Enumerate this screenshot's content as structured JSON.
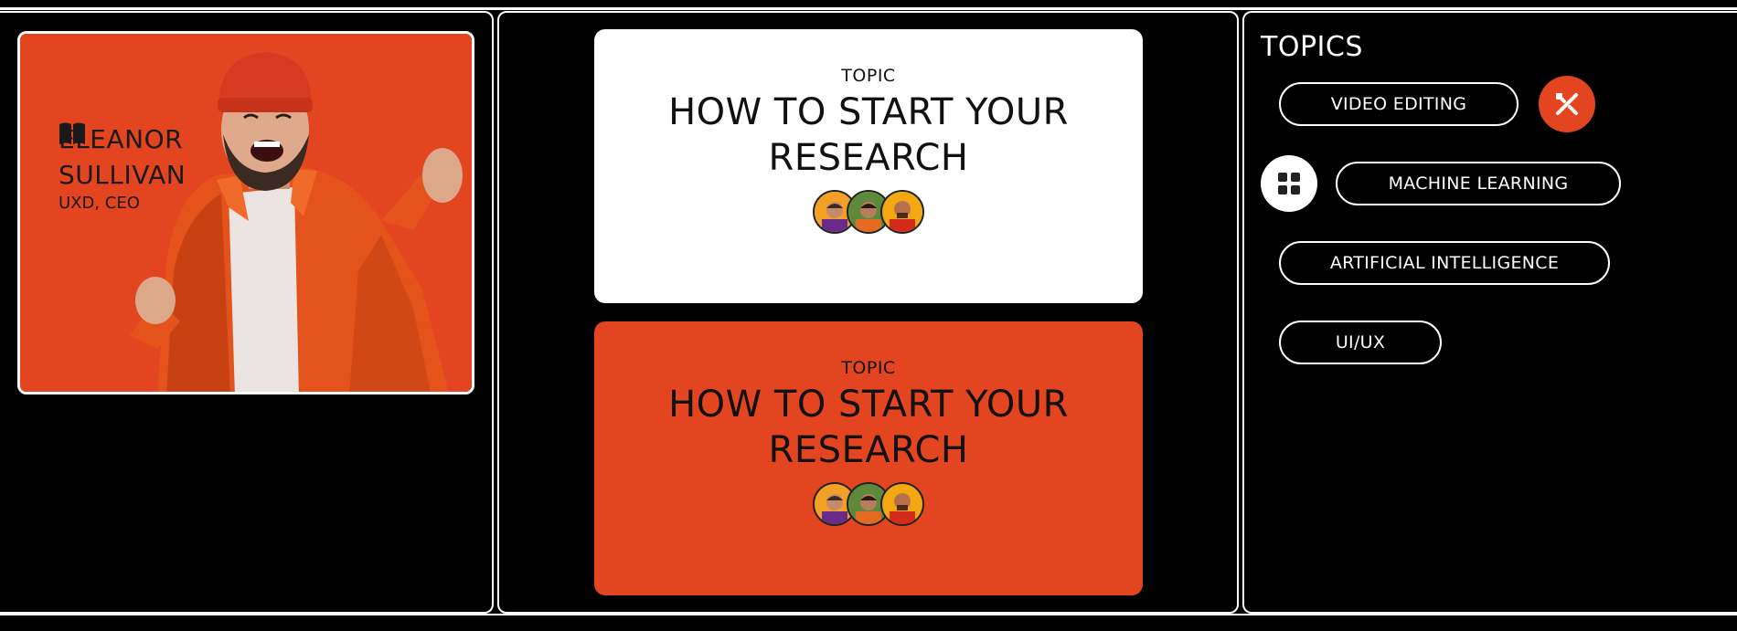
{
  "profile": {
    "first_name": "ELEANOR",
    "last_name": "SULLIVAN",
    "role": "UXD, CEO",
    "icon": "book-icon",
    "background_color": "#e34520"
  },
  "cards": [
    {
      "label": "TOPIC",
      "title": "HOW TO START YOUR RESEARCH",
      "background": "#ffffff"
    },
    {
      "label": "TOPIC",
      "title": "HOW TO START YOUR RESEARCH",
      "background": "#e34520"
    }
  ],
  "topics": {
    "heading": "TOPICS",
    "items": [
      {
        "label": "VIDEO EDITING"
      },
      {
        "label": "MACHINE LEARNING"
      },
      {
        "label": "ARTIFICIAL INTELLIGENCE"
      },
      {
        "label": "UI/UX"
      }
    ],
    "icons": [
      "design-tools-icon",
      "grid-icon"
    ]
  },
  "colors": {
    "accent": "#e34520",
    "background": "#000000",
    "text": "#ffffff"
  }
}
